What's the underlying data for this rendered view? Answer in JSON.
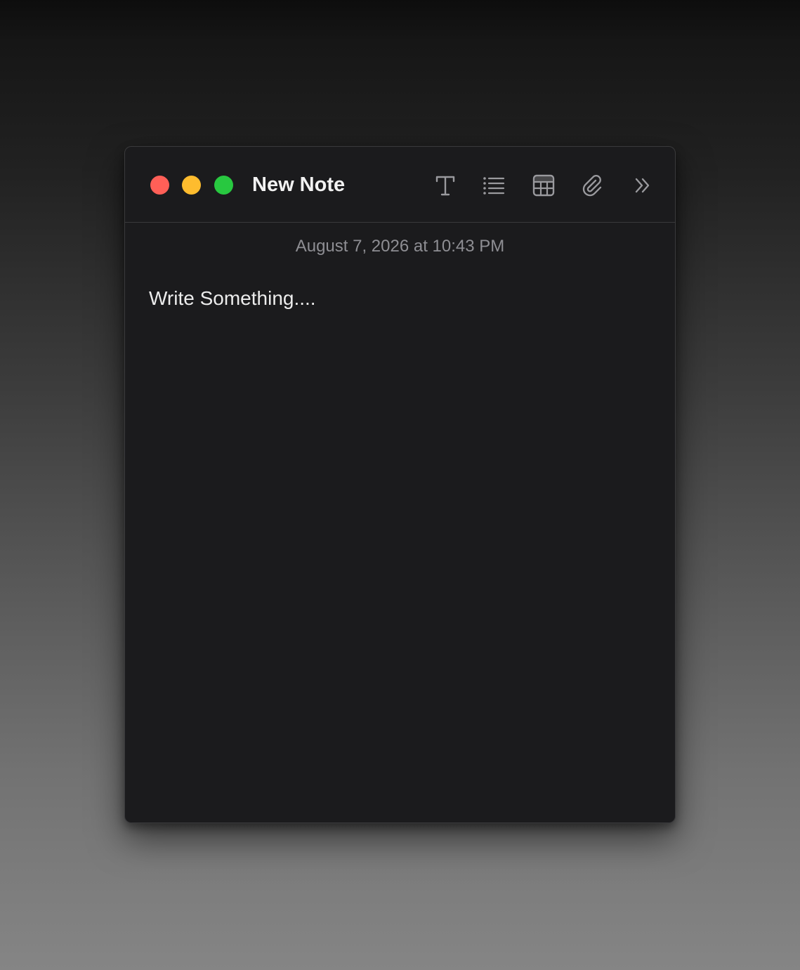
{
  "window": {
    "title": "New Note"
  },
  "traffic_lights": {
    "close": "#ff5f57",
    "minimize": "#febc2e",
    "zoom": "#28c840"
  },
  "toolbar": {
    "icons": [
      "text-format-icon",
      "bulleted-list-icon",
      "table-icon",
      "paperclip-icon",
      "double-chevron-right-icon"
    ]
  },
  "note": {
    "timestamp": "August 7, 2026 at 10:43 PM",
    "body_placeholder": "Write Something...."
  },
  "colors": {
    "window_bg": "#1b1b1d",
    "icon": "#9a9a9e",
    "title_text": "#f2f2f2",
    "timestamp_text": "#8e8e93"
  }
}
